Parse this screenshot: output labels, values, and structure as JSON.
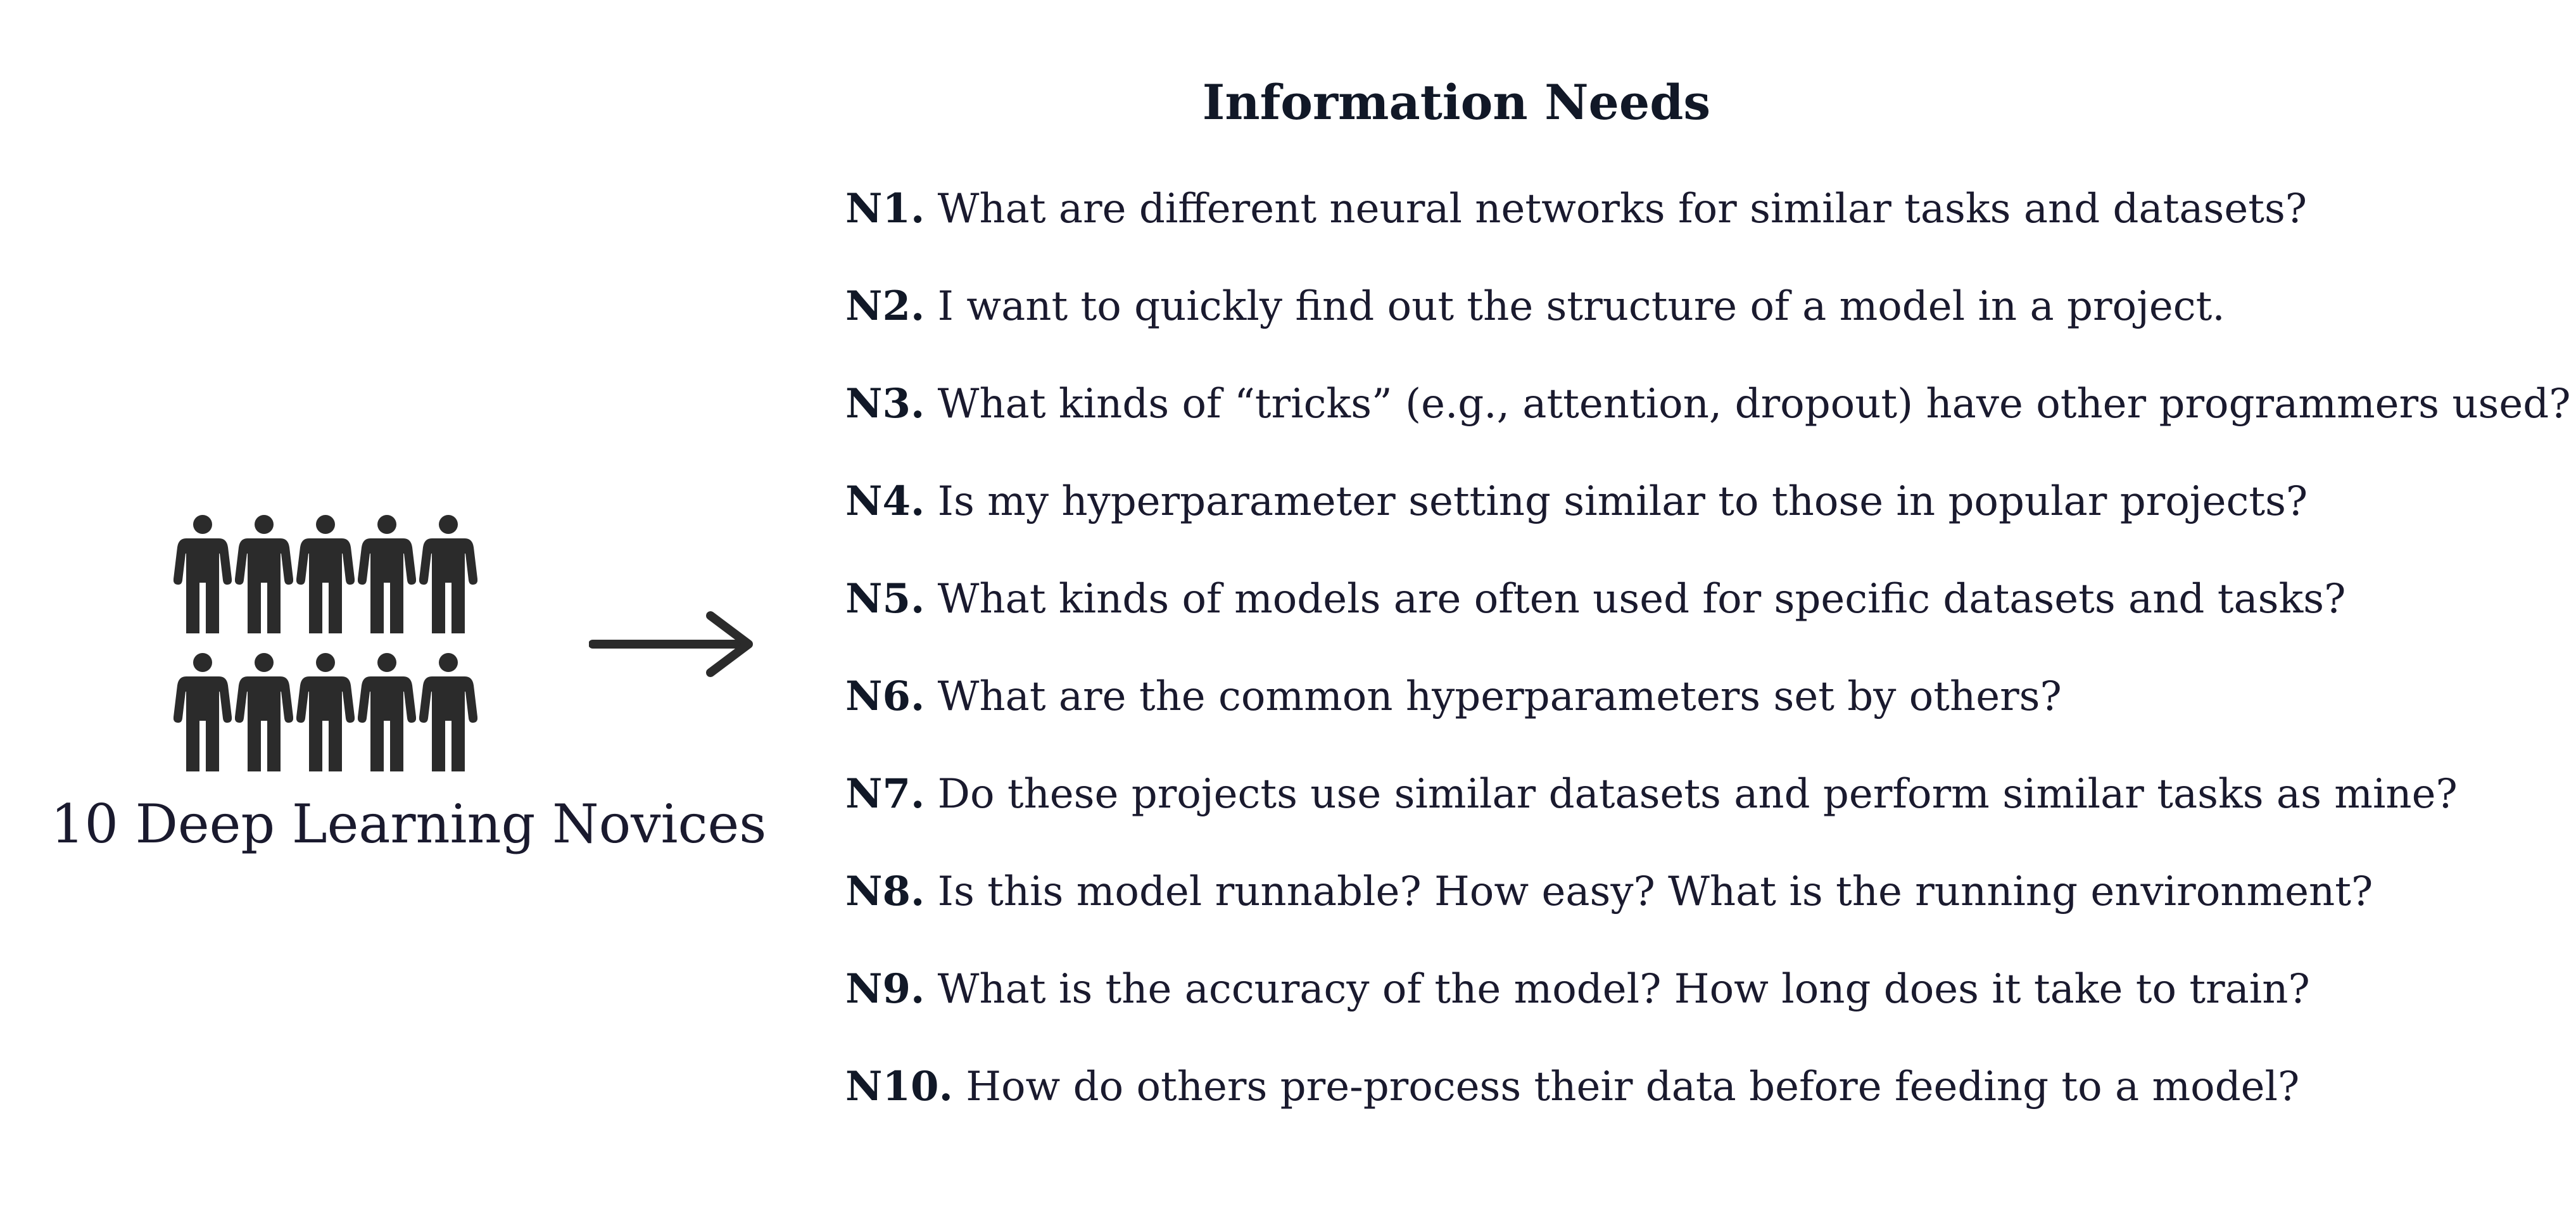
{
  "colors": {
    "text": "#1a1a2e",
    "icon": "#2b2b2b",
    "background": "#ffffff"
  },
  "participants": {
    "count": 10,
    "icon": "person-icon",
    "label": "10 Deep Learning Novices"
  },
  "connector": {
    "icon": "right-arrow-icon"
  },
  "needs": {
    "title": "Information Needs",
    "items": [
      {
        "id": "N1.",
        "text": "What are different neural networks for similar tasks and datasets?"
      },
      {
        "id": "N2.",
        "text": "I want to quickly find out the structure of a model in a project."
      },
      {
        "id": "N3.",
        "text": "What kinds of “tricks” (e.g., attention, dropout) have other programmers used?"
      },
      {
        "id": "N4.",
        "text": "Is my hyperparameter setting similar to those in popular projects?"
      },
      {
        "id": "N5.",
        "text": "What kinds of models are often used for specific datasets and tasks?"
      },
      {
        "id": "N6.",
        "text": "What are the common hyperparameters set by others?"
      },
      {
        "id": "N7.",
        "text": "Do these projects use similar datasets and perform similar tasks as mine?"
      },
      {
        "id": "N8.",
        "text": "Is this model runnable? How easy? What is the running environment?"
      },
      {
        "id": "N9.",
        "text": "What is the accuracy of the model? How long does it take to train?"
      },
      {
        "id": "N10.",
        "text": "How do others pre-process their data before feeding to a model?"
      }
    ]
  }
}
